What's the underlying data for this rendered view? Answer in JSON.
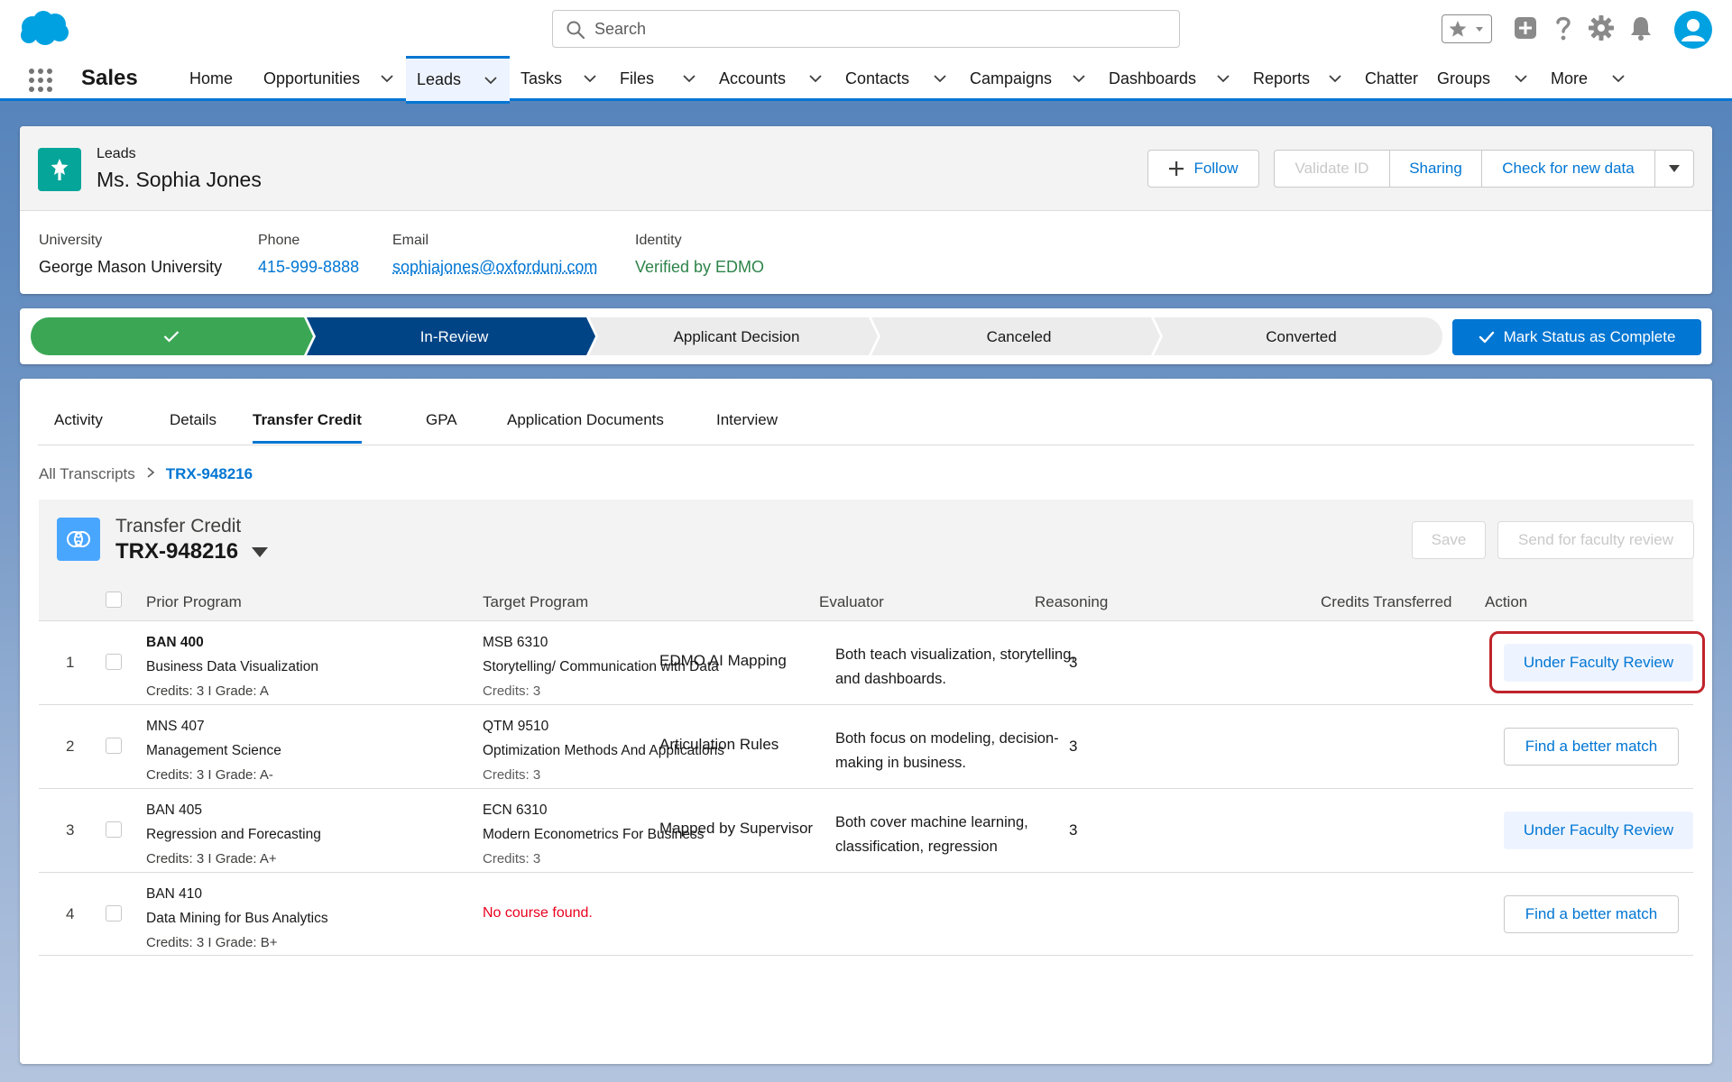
{
  "global_header": {
    "search_placeholder": "Search"
  },
  "nav": {
    "app_name": "Sales",
    "items": [
      {
        "label": "Home",
        "dropdown": false
      },
      {
        "label": "Opportunities",
        "dropdown": true
      },
      {
        "label": "Leads",
        "dropdown": true,
        "active": true
      },
      {
        "label": "Tasks",
        "dropdown": true
      },
      {
        "label": "Files",
        "dropdown": true
      },
      {
        "label": "Accounts",
        "dropdown": true
      },
      {
        "label": "Contacts",
        "dropdown": true
      },
      {
        "label": "Campaigns",
        "dropdown": true
      },
      {
        "label": "Dashboards",
        "dropdown": true
      },
      {
        "label": "Reports",
        "dropdown": true
      },
      {
        "label": "Chatter",
        "dropdown": false
      },
      {
        "label": "Groups",
        "dropdown": true
      },
      {
        "label": "More",
        "dropdown": true
      }
    ]
  },
  "record": {
    "object_label": "Leads",
    "name": "Ms. Sophia Jones",
    "buttons": {
      "follow": "Follow",
      "validate": "Validate ID",
      "sharing": "Sharing",
      "check": "Check for new data"
    },
    "fields": [
      {
        "label": "University",
        "value": "George Mason University",
        "style": "plain"
      },
      {
        "label": "Phone",
        "value": "415-999-8888",
        "style": "link"
      },
      {
        "label": "Email",
        "value": "sophiajones@oxforduni.com",
        "style": "email"
      },
      {
        "label": "Identity",
        "value": "Verified by EDMO",
        "style": "green"
      }
    ]
  },
  "path": {
    "stages": [
      {
        "label": "",
        "state": "complete"
      },
      {
        "label": "In-Review",
        "state": "current"
      },
      {
        "label": "Applicant Decision",
        "state": "incomplete"
      },
      {
        "label": "Canceled",
        "state": "incomplete"
      },
      {
        "label": "Converted",
        "state": "incomplete"
      }
    ],
    "mark_button": "Mark Status as Complete",
    "colors": {
      "complete": "#3ba755",
      "current": "#014486",
      "incomplete": "#ececec"
    }
  },
  "tabs": [
    {
      "label": "Activity"
    },
    {
      "label": "Details"
    },
    {
      "label": "Transfer Credit",
      "active": true
    },
    {
      "label": "GPA"
    },
    {
      "label": "Application Documents"
    },
    {
      "label": "Interview"
    }
  ],
  "breadcrumb": {
    "parent": "All Transcripts",
    "current": "TRX-948216"
  },
  "transfer_credit": {
    "label": "Transfer Credit",
    "id": "TRX-948216",
    "save_label": "Save",
    "send_label": "Send for faculty review",
    "columns": {
      "prior": "Prior Program",
      "target": "Target Program",
      "evaluator": "Evaluator",
      "reasoning": "Reasoning",
      "credits": "Credits Transferred",
      "action": "Action"
    },
    "rows": [
      {
        "num": "1",
        "prior_code": "BAN 400",
        "prior_title": "Business Data Visualization",
        "prior_meta": "Credits: 3  I  Grade: A",
        "target_code": "MSB 6310",
        "target_title": "Storytelling/ Communication with Data",
        "target_meta": "Credits: 3",
        "evaluator": "EDMO AI Mapping",
        "reasoning": "Both teach visualization, storytelling, and dashboards.",
        "credits": "3",
        "action": "Under Faculty Review"
      },
      {
        "num": "2",
        "prior_code": "MNS 407",
        "prior_title": "Management Science",
        "prior_meta": "Credits: 3  I  Grade: A-",
        "target_code": "QTM 9510",
        "target_title": "Optimization Methods And Applications",
        "target_meta": "Credits: 3",
        "evaluator": "Articulation Rules",
        "reasoning": "Both focus on modeling, decision-making in business.",
        "credits": "3",
        "action": "Find a better match"
      },
      {
        "num": "3",
        "prior_code": "BAN 405",
        "prior_title": "Regression and Forecasting",
        "prior_meta": "Credits: 3  I  Grade: A+",
        "target_code": "ECN 6310",
        "target_title": "Modern Econometrics For Business",
        "target_meta": "Credits: 3",
        "evaluator": "Mapped by Supervisor",
        "reasoning": "Both cover machine learning, classification, regression",
        "credits": "3",
        "action": "Under Faculty Review"
      },
      {
        "num": "4",
        "prior_code": "BAN 410",
        "prior_title": "Data Mining for Bus Analytics",
        "prior_meta": "Credits: 3  I  Grade: B+",
        "no_course": "No course found.",
        "action": "Find a better match"
      }
    ]
  }
}
